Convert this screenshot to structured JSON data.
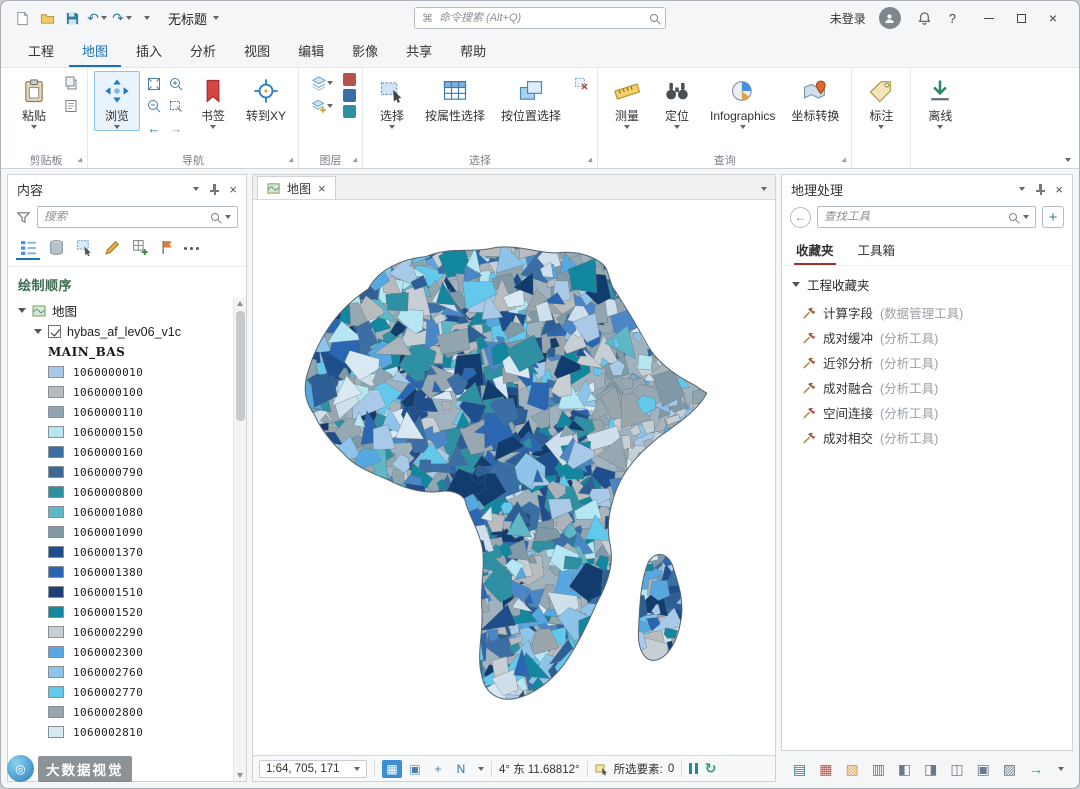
{
  "titlebar": {
    "title": "无标题",
    "command_search_placeholder": "命令搜索 (Alt+Q)",
    "sign_in_label": "未登录",
    "help_label": "?"
  },
  "ribbon": {
    "tabs": [
      {
        "label": "工程"
      },
      {
        "label": "地图"
      },
      {
        "label": "插入"
      },
      {
        "label": "分析"
      },
      {
        "label": "视图"
      },
      {
        "label": "编辑"
      },
      {
        "label": "影像"
      },
      {
        "label": "共享"
      },
      {
        "label": "帮助"
      }
    ],
    "active_tab": "地图",
    "buttons": {
      "paste": "粘贴",
      "explore": "浏览",
      "bookmarks": "书签",
      "goto_xy": "转到XY",
      "select": "选择",
      "select_by_attributes": "按属性选择",
      "select_by_location": "按位置选择",
      "measure": "测量",
      "locate": "定位",
      "infographics": "Infographics",
      "convert_coordinates": "坐标转换",
      "labeling": "标注",
      "offline": "离线"
    },
    "group_labels": {
      "clipboard": "剪贴板",
      "navigate": "导航",
      "layer": "图层",
      "selection": "选择",
      "inquiry": "查询"
    }
  },
  "contents_panel": {
    "title": "内容",
    "search_placeholder": "搜索",
    "drawing_order_heading": "绘制顺序",
    "map_item": "地图",
    "layer_item": "hybas_af_lev06_v1c",
    "field_heading": "MAIN_BAS",
    "legend": [
      {
        "id": "1060000010",
        "color": "#a9c9e9"
      },
      {
        "id": "1060000100",
        "color": "#b9bcbf"
      },
      {
        "id": "1060000110",
        "color": "#8fa6b0"
      },
      {
        "id": "1060000150",
        "color": "#b5e6f2"
      },
      {
        "id": "1060000160",
        "color": "#3a6ea5"
      },
      {
        "id": "1060000790",
        "color": "#3d6a91"
      },
      {
        "id": "1060000800",
        "color": "#2f8fa3"
      },
      {
        "id": "1060001080",
        "color": "#5fb6c6"
      },
      {
        "id": "1060001090",
        "color": "#7f9aa6"
      },
      {
        "id": "1060001370",
        "color": "#1f4e8c"
      },
      {
        "id": "1060001380",
        "color": "#2a66b2"
      },
      {
        "id": "1060001510",
        "color": "#203f76"
      },
      {
        "id": "1060001520",
        "color": "#1487a0"
      },
      {
        "id": "1060002290",
        "color": "#c7ced4"
      },
      {
        "id": "1060002300",
        "color": "#57a7e0"
      },
      {
        "id": "1060002760",
        "color": "#8fc4ea"
      },
      {
        "id": "1060002770",
        "color": "#63c9ec"
      },
      {
        "id": "1060002800",
        "color": "#9aa6ab"
      },
      {
        "id": "1060002810",
        "color": "#d9e9f3"
      }
    ]
  },
  "map_view": {
    "tab_label": "地图",
    "status": {
      "scale": "1:64, 705, 171",
      "coordinates": "4° 东 11.68812°",
      "selected_label": "所选要素:",
      "selected_count": "0"
    },
    "status_icons": [
      {
        "name": "select-features-icon",
        "glyph": "▦",
        "fg": "#ffffff",
        "bg": "#3d8fd1"
      },
      {
        "name": "snapping-icon",
        "glyph": "▣",
        "fg": "#4a7fa8",
        "bg": "transparent"
      },
      {
        "name": "pan-crosshair-icon",
        "glyph": "+",
        "fg": "#4a7fa8",
        "bg": "transparent"
      },
      {
        "name": "north-arrow-icon",
        "glyph": "N",
        "fg": "#3a6ea5",
        "bg": "transparent"
      }
    ]
  },
  "geoprocessing_panel": {
    "title": "地理处理",
    "search_placeholder": "查找工具",
    "tabs": [
      {
        "label": "收藏夹"
      },
      {
        "label": "工具箱"
      }
    ],
    "active_tab": "收藏夹",
    "favorites_group": "工程收藏夹",
    "tools": [
      {
        "name": "计算字段",
        "toolbox": "(数据管理工具)"
      },
      {
        "name": "成对缓冲",
        "toolbox": "(分析工具)"
      },
      {
        "name": "近邻分析",
        "toolbox": "(分析工具)"
      },
      {
        "name": "成对融合",
        "toolbox": "(分析工具)"
      },
      {
        "name": "空间连接",
        "toolbox": "(分析工具)"
      },
      {
        "name": "成对相交",
        "toolbox": "(分析工具)"
      }
    ]
  },
  "dock_icons": [
    {
      "name": "contents-pane-icon",
      "glyph": "▤",
      "fg": "#2a7f93"
    },
    {
      "name": "catalog-pane-icon",
      "glyph": "▦",
      "fg": "#b5534a"
    },
    {
      "name": "symbology-pane-icon",
      "glyph": "▧",
      "fg": "#d79b2e"
    },
    {
      "name": "attribute-table-icon",
      "glyph": "▥",
      "fg": "#5a8a3a"
    },
    {
      "name": "layout-pane-icon",
      "glyph": "◧",
      "fg": "#6a7a8a"
    },
    {
      "name": "print-icon",
      "glyph": "◨",
      "fg": "#6a7a8a"
    },
    {
      "name": "python-window-icon",
      "glyph": "◫",
      "fg": "#6a7a8a"
    },
    {
      "name": "task-pane-icon",
      "glyph": "▣",
      "fg": "#6a7a8a"
    },
    {
      "name": "notifications-pane-icon",
      "glyph": "▨",
      "fg": "#6a7a8a"
    },
    {
      "name": "run-status-icon",
      "glyph": "→",
      "fg": "#2a9d6a"
    }
  ],
  "watermark": {
    "text": "大数据视觉"
  },
  "map": {
    "palette_blue": [
      "#1f4e8c",
      "#2a66b2",
      "#3a6ea5",
      "#2d5f96",
      "#1487a0",
      "#2f8fa3",
      "#4b87c6",
      "#123c6e"
    ],
    "palette_light": [
      "#a9c9e9",
      "#b5e6f2",
      "#8fc4ea",
      "#63c9ec",
      "#d9e9f3",
      "#5fb6c6",
      "#57a7e0",
      "#cfe0ec"
    ],
    "palette_gray": [
      "#b9bcbf",
      "#9aa6ab",
      "#8fa6b0",
      "#c7ced4",
      "#aab4ba",
      "#7f9aa6",
      "#98a8b2"
    ]
  }
}
